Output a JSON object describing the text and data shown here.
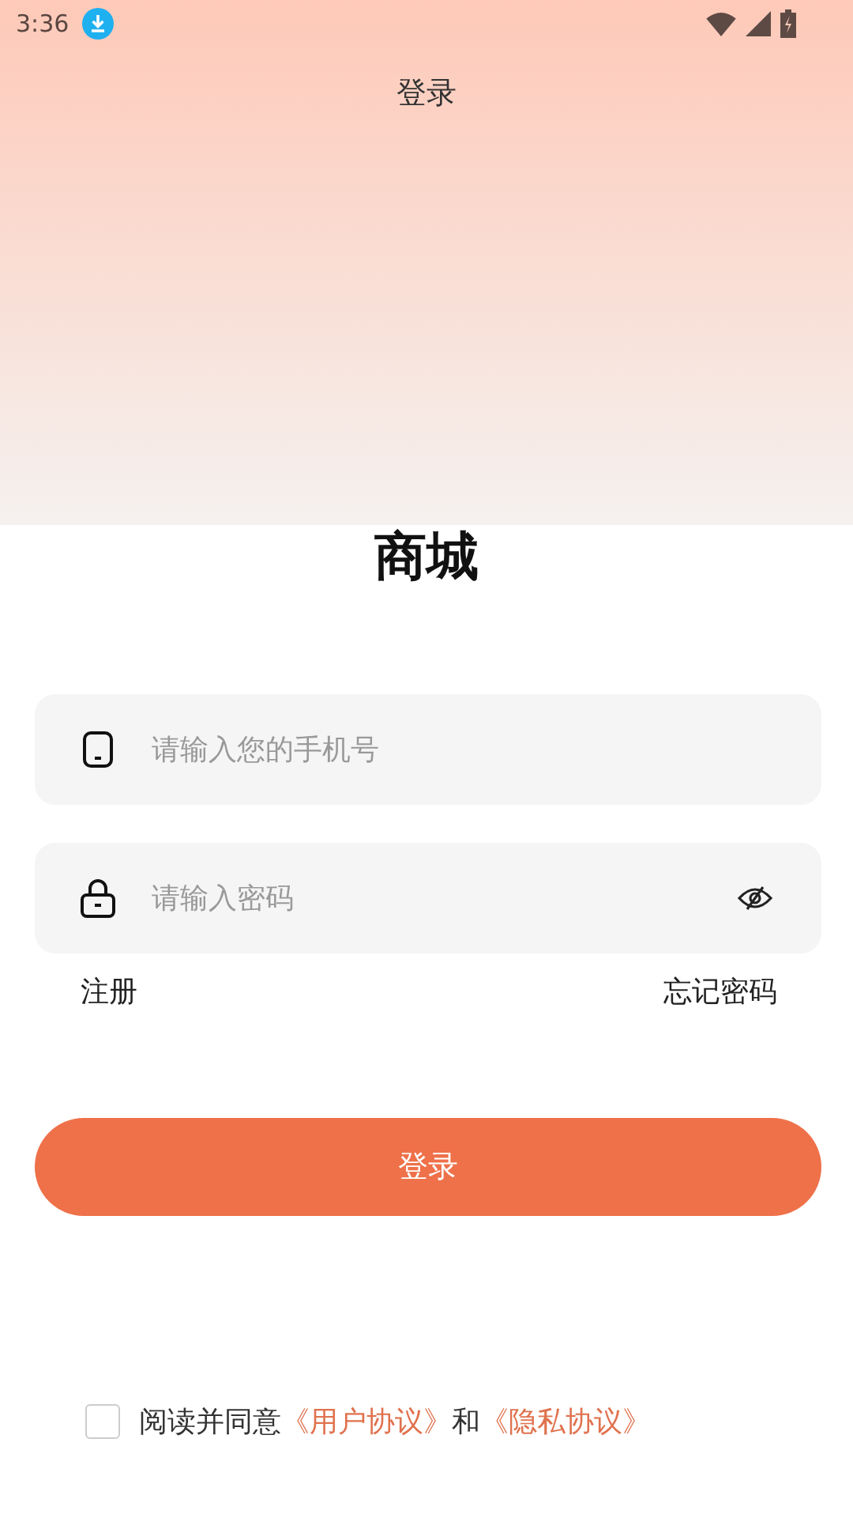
{
  "status_bar": {
    "time": "3:36"
  },
  "title": "登录",
  "heading": "商城",
  "fields": [
    {
      "kind": "phone",
      "placeholder": "请输入您的手机号"
    },
    {
      "kind": "password",
      "placeholder": "请输入密码"
    }
  ],
  "links": [
    {
      "label": "注册"
    },
    {
      "label": "忘记密码"
    }
  ],
  "login_button": "登录",
  "agreement": {
    "checked": false,
    "parts": [
      {
        "kind": "plain",
        "text": "阅读并同意"
      },
      {
        "kind": "link",
        "text": "《用户协议》"
      },
      {
        "kind": "plain",
        "text": "和"
      },
      {
        "kind": "link",
        "text": "《隐私协议》"
      }
    ]
  }
}
